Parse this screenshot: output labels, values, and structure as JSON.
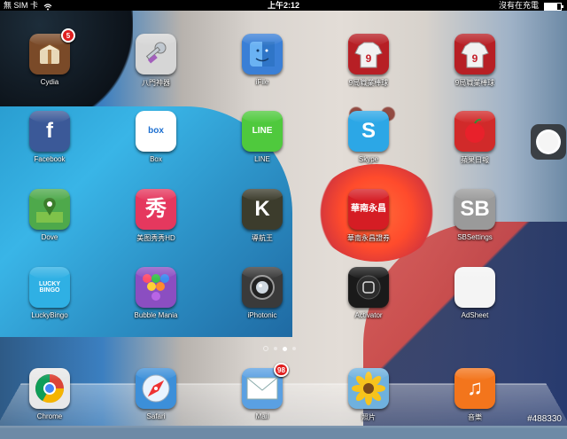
{
  "status": {
    "carrier": "無 SIM 卡",
    "time": "上午2:12",
    "charging": "沒有在充電",
    "battery_level": 0.8
  },
  "pager": {
    "pages": 3,
    "active": 1
  },
  "apps": [
    {
      "id": "cydia",
      "label": "Cydia",
      "icon": "cydia-icon",
      "color": "#7a4a28",
      "badge": "5"
    },
    {
      "id": "keys",
      "label": "八門神器",
      "icon": "key-icon",
      "color": "#d6d6d6"
    },
    {
      "id": "ifile",
      "label": "iFile",
      "icon": "finder-icon",
      "color": "#3a7fd6"
    },
    {
      "id": "baseball1",
      "label": "9局職業棒球",
      "icon": "baseball-jersey-icon",
      "color": "#b71f25"
    },
    {
      "id": "baseball2",
      "label": "9局職業棒球",
      "icon": "baseball-jersey-icon",
      "color": "#b71f25"
    },
    {
      "id": "facebook",
      "label": "Facebook",
      "icon": "facebook-icon",
      "color": "#3b5998",
      "glyph": "f"
    },
    {
      "id": "box",
      "label": "Box",
      "icon": "box-icon",
      "color": "#ffffff",
      "glyph": "box"
    },
    {
      "id": "line",
      "label": "LINE",
      "icon": "line-chat-icon",
      "color": "#4fc93d",
      "glyph": "LINE"
    },
    {
      "id": "skype",
      "label": "Skype",
      "icon": "skype-icon",
      "color": "#2ca7e6",
      "glyph": "S"
    },
    {
      "id": "apple_daily",
      "label": "蘋果日報",
      "icon": "apple-icon",
      "color": "#d12a2a"
    },
    {
      "id": "dove",
      "label": "Dove",
      "icon": "map-pin-icon",
      "color": "#4ea94b"
    },
    {
      "id": "meitu",
      "label": "美图秀秀HD",
      "icon": "meitu-icon",
      "color": "#e5385e",
      "glyph": "秀"
    },
    {
      "id": "navking",
      "label": "導航王",
      "icon": "navigation-icon",
      "color": "#3c3c2c",
      "glyph": "K"
    },
    {
      "id": "hnsec",
      "label": "華南永昌證券",
      "icon": "bank-logo-icon",
      "color": "#d51d24",
      "glyph": "華南永昌"
    },
    {
      "id": "sbsettings",
      "label": "SBSettings",
      "icon": "sbsettings-icon",
      "color": "#9a9a9a",
      "glyph": "SB"
    },
    {
      "id": "luckybingo",
      "label": "LuckyBingo",
      "icon": "bingo-icon",
      "color": "#2fb0e4",
      "glyph": "LUCKY BINGO"
    },
    {
      "id": "bubblemania",
      "label": "Bubble Mania",
      "icon": "bubbles-icon",
      "color": "#8b4ec1"
    },
    {
      "id": "iphotonic",
      "label": "iPhotonic",
      "icon": "lens-icon",
      "color": "#3a3a3a"
    },
    {
      "id": "activator",
      "label": "Activator",
      "icon": "home-button-icon",
      "color": "#1a1a1a"
    },
    {
      "id": "adsheet",
      "label": "AdSheet",
      "icon": "blank-sheet-icon",
      "color": "#f4f4f4"
    }
  ],
  "dock": [
    {
      "id": "chrome",
      "label": "Chrome",
      "icon": "chrome-icon",
      "color": "#e8e8e8"
    },
    {
      "id": "safari",
      "label": "Safari",
      "icon": "compass-icon",
      "color": "#3c8fd9"
    },
    {
      "id": "mail",
      "label": "Mail",
      "icon": "envelope-icon",
      "color": "#5aa0e2",
      "badge": "98"
    },
    {
      "id": "photos",
      "label": "照片",
      "icon": "sunflower-icon",
      "color": "#6fb1de"
    },
    {
      "id": "music",
      "label": "音樂",
      "icon": "music-note-icon",
      "color": "#f3751c",
      "glyph": "♫"
    }
  ],
  "watermark": "#488330"
}
